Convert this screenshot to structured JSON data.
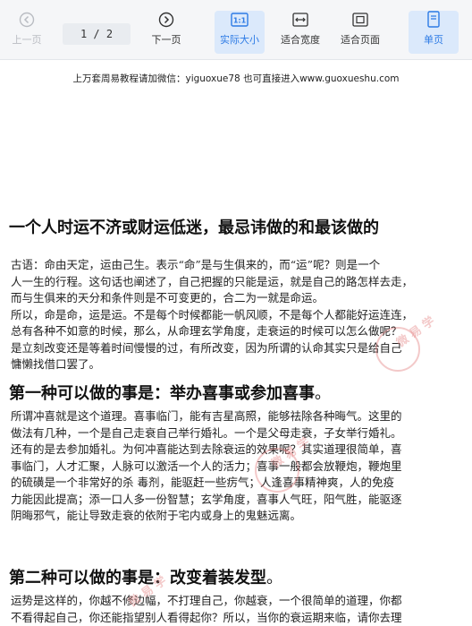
{
  "toolbar": {
    "prev_label": "上一页",
    "page_indicator": "1 / 2",
    "next_label": "下一页",
    "actual_size_label": "实际大小",
    "fit_width_label": "适合宽度",
    "fit_page_label": "适合页面",
    "single_page_label": "单页"
  },
  "document": {
    "header_note": "上万套周易教程请加微信：yiguoxue78  也可直接进入www.guoxueshu.com",
    "title": "一个人时运不济或财运低迷，最忌讳做的和最该做的",
    "intro_lines": [
      "古语：命由天定，运由己生。表示“命”是与生俱来的，而“运”呢？则是一个",
      "人一生的行程。这句话也阐述了，自己把握的只能是运，就是自己的路怎样去走，",
      "而与生俱来的天分和条件则是不可变更的，合二为一就是命运。",
      "所以，命是命，运是运。不是每个时候都能一帆风顺，不是每个人都能好运连连，",
      "总有各种不如意的时候，那么，从命理玄学角度，走衰运的时候可以怎么做呢？",
      "是立刻改变还是等着时间慢慢的过，有所改变，因为所谓的认命其实只是给自己",
      "慵懒找借口罢了。"
    ],
    "section1_heading": "第一种可以做的事是：举办喜事或参加喜事",
    "section1_heading_suffix": "。",
    "section1_lines": [
      "所谓冲喜就是这个道理。喜事临门，能有吉星高照，能够祛除各种晦气。这里的",
      "做法有几种，一个是自己走衰自己举行婚礼。一个是父母走衰，子女举行婚礼。",
      "还有的是去参加婚礼。为何冲喜能达到去除衰运的效果呢？其实道理很简单，喜",
      "事临门，人才汇聚，人脉可以激活一个人的活力；喜事一般都会放鞭炮，鞭炮里",
      "的硫磺是一个非常好的杀  毒剂，能驱赶一些疠气；人逢喜事精神爽，人的免疫",
      "力能因此提高；添一口人多一份智慧；玄学角度，喜事人气旺，阳气胜，能驱逐",
      "阴晦邪气，能让导致走衰的依附于宅内或身上的鬼魅远离。"
    ],
    "section2_heading": "第二种可以做的事是：改变着装发型",
    "section2_heading_suffix": "。",
    "section2_lines": [
      "运势是这样的，你越不修边幅，不打理自己，你越衰，一个很简单的道理，你都",
      "不看得起自己，你还能指望别人看得起你？所以，当你的衰运期来临，请你去理"
    ]
  },
  "colors": {
    "toolbar_bg": "#f5f6f8",
    "active_bg": "#dbe9fb",
    "accent": "#2d7be5",
    "disabled": "#b9bcc2",
    "watermark": "#e58a8a"
  }
}
